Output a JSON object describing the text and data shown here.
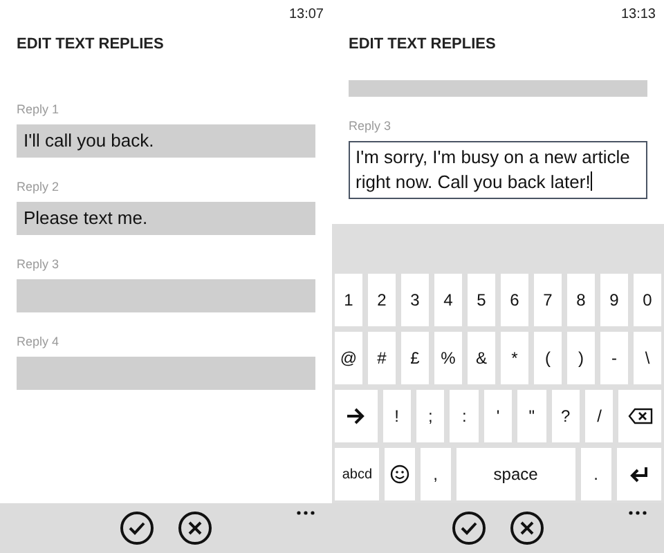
{
  "screens": [
    {
      "time": "13:07",
      "title": "EDIT TEXT REPLIES",
      "fields": [
        {
          "kind": "reply",
          "label": "Reply 1",
          "value": "I'll call you back.",
          "focused": false
        },
        {
          "kind": "reply",
          "label": "Reply 2",
          "value": "Please text me.",
          "focused": false
        },
        {
          "kind": "reply",
          "label": "Reply 3",
          "focused": false
        },
        {
          "kind": "reply",
          "label": "Reply 4",
          "focused": false
        }
      ]
    },
    {
      "time": "13:13",
      "title": "EDIT TEXT REPLIES",
      "fields": [
        {
          "kind": "clipped"
        },
        {
          "kind": "reply",
          "label": "Reply 3",
          "value": "I'm sorry, I'm busy on a new article right now. Call you back later!",
          "focused": true
        }
      ],
      "keyboard": {
        "rows": [
          {
            "keys": [
              {
                "kind": "char",
                "label": "1"
              },
              {
                "kind": "char",
                "label": "2"
              },
              {
                "kind": "char",
                "label": "3"
              },
              {
                "kind": "char",
                "label": "4"
              },
              {
                "kind": "char",
                "label": "5"
              },
              {
                "kind": "char",
                "label": "6"
              },
              {
                "kind": "char",
                "label": "7"
              },
              {
                "kind": "char",
                "label": "8"
              },
              {
                "kind": "char",
                "label": "9"
              },
              {
                "kind": "char",
                "label": "0"
              }
            ]
          },
          {
            "keys": [
              {
                "kind": "char",
                "label": "@"
              },
              {
                "kind": "char",
                "label": "#"
              },
              {
                "kind": "char",
                "label": "£"
              },
              {
                "kind": "char",
                "label": "%"
              },
              {
                "kind": "char",
                "label": "&"
              },
              {
                "kind": "char",
                "label": "*"
              },
              {
                "kind": "char",
                "label": "("
              },
              {
                "kind": "char",
                "label": ")"
              },
              {
                "kind": "char",
                "label": "-"
              },
              {
                "kind": "char",
                "label": "\\"
              }
            ]
          },
          {
            "keys": [
              {
                "kind": "shift"
              },
              {
                "kind": "char",
                "label": "!"
              },
              {
                "kind": "char",
                "label": ";"
              },
              {
                "kind": "char",
                "label": ":"
              },
              {
                "kind": "char",
                "label": "'"
              },
              {
                "kind": "char",
                "label": "\""
              },
              {
                "kind": "char",
                "label": "?"
              },
              {
                "kind": "char",
                "label": "/"
              },
              {
                "kind": "backspace"
              }
            ]
          },
          {
            "keys": [
              {
                "kind": "mode",
                "label": "abcd"
              },
              {
                "kind": "emoji"
              },
              {
                "kind": "char",
                "label": ","
              },
              {
                "kind": "space",
                "label": "space"
              },
              {
                "kind": "char",
                "label": "."
              },
              {
                "kind": "enter"
              }
            ]
          }
        ]
      }
    }
  ]
}
